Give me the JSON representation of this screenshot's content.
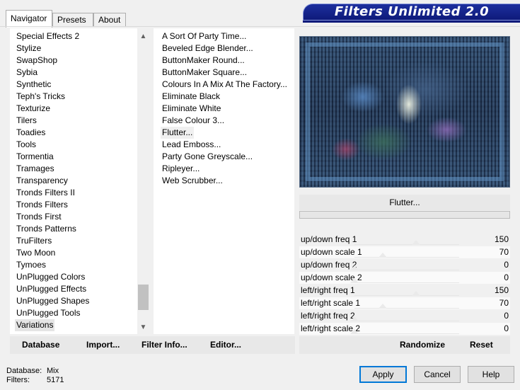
{
  "tabs": [
    "Navigator",
    "Presets",
    "About"
  ],
  "banner": "Filters Unlimited 2.0",
  "categories": [
    "Special Effects 2",
    "Stylize",
    "SwapShop",
    "Sybia",
    "Synthetic",
    "Teph's Tricks",
    "Texturize",
    "Tilers",
    "Toadies",
    "Tools",
    "Tormentia",
    "Tramages",
    "Transparency",
    "Tronds Filters II",
    "Tronds Filters",
    "Tronds First",
    "Tronds Patterns",
    "TruFilters",
    "Two Moon",
    "Tymoes",
    "UnPlugged Colors",
    "UnPlugged Effects",
    "UnPlugged Shapes",
    "UnPlugged Tools",
    "Variations"
  ],
  "selected_category": "Variations",
  "filters": [
    "A Sort Of Party Time...",
    "Beveled Edge Blender...",
    "ButtonMaker Round...",
    "ButtonMaker Square...",
    "Colours In A Mix At The Factory...",
    "Eliminate Black",
    "Eliminate White",
    "False Colour 3...",
    "Flutter...",
    "Lead Emboss...",
    "Party Gone Greyscale...",
    "Ripleyer...",
    "Web Scrubber..."
  ],
  "selected_filter": "Flutter...",
  "filter_title": "Flutter...",
  "params": [
    {
      "label": "up/down freq 1",
      "value": "150",
      "fraction": 0.59
    },
    {
      "label": "up/down scale 1",
      "value": "70",
      "fraction": 0.27
    },
    {
      "label": "up/down freq 2",
      "value": "0",
      "fraction": 0.0
    },
    {
      "label": "up/down scale 2",
      "value": "0",
      "fraction": 0.0
    },
    {
      "label": "left/right freq 1",
      "value": "150",
      "fraction": 0.59
    },
    {
      "label": "left/right scale 1",
      "value": "70",
      "fraction": 0.27
    },
    {
      "label": "left/right freq 2",
      "value": "0",
      "fraction": 0.0
    },
    {
      "label": "left/right scale 2",
      "value": "0",
      "fraction": 0.0
    }
  ],
  "commands": {
    "database": "Database",
    "import": "Import...",
    "filter_info": "Filter Info...",
    "editor": "Editor...",
    "randomize": "Randomize",
    "reset": "Reset"
  },
  "status": {
    "db_label": "Database:",
    "db_value": "Mix",
    "filters_label": "Filters:",
    "filters_value": "5171"
  },
  "buttons": {
    "apply": "Apply",
    "cancel": "Cancel",
    "help": "Help"
  },
  "colors": {
    "banner_bg": "#14248a",
    "banner_text": "#ffffff",
    "default_button_border": "#0078d7"
  }
}
